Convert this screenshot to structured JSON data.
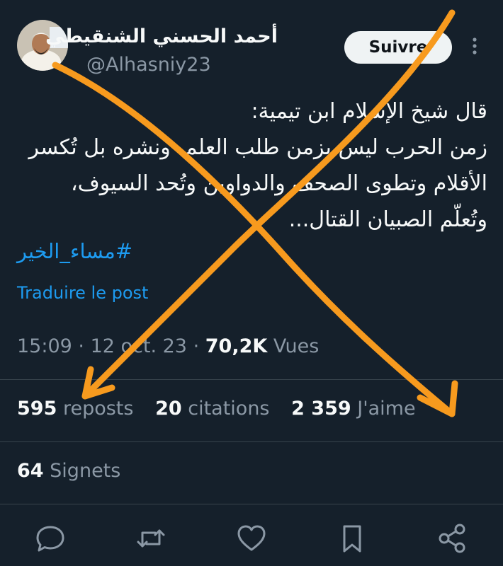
{
  "author": {
    "display_name": "أحمد الحسني الشنقيطي",
    "handle": "@Alhasniy23"
  },
  "header": {
    "follow_label": "Suivre"
  },
  "tweet": {
    "lines": [
      "قال شيخ الإسلام ابن تيمية:",
      "زمن الحرب ليس بزمن طلب العلم، ونشره بل تُكسر",
      "الأقلام وتطوى الصحف والدواوين وتُحد السيوف،",
      "وتُعلّم الصبيان القتال..."
    ],
    "hashtag": "#مساء_الخير",
    "translate_label": "Traduire le post"
  },
  "meta": {
    "time": "15:09",
    "date": "12 oct. 23",
    "views_count": "70,2K",
    "views_label": "Vues"
  },
  "stats": {
    "reposts_count": "595",
    "reposts_label": "reposts",
    "quotes_count": "20",
    "quotes_label": "citations",
    "likes_count": "2 359",
    "likes_label": "J'aime",
    "bookmarks_count": "64",
    "bookmarks_label": "Signets"
  },
  "icons": {
    "actions": [
      "reply-icon",
      "repost-icon",
      "like-icon",
      "bookmark-icon",
      "share-icon"
    ],
    "more": "more-vertical-icon"
  },
  "colors": {
    "background": "#15202b",
    "text": "#f7f9f9",
    "muted": "#8b98a5",
    "link": "#1d9bf0",
    "annotation": "#f79a1e"
  }
}
